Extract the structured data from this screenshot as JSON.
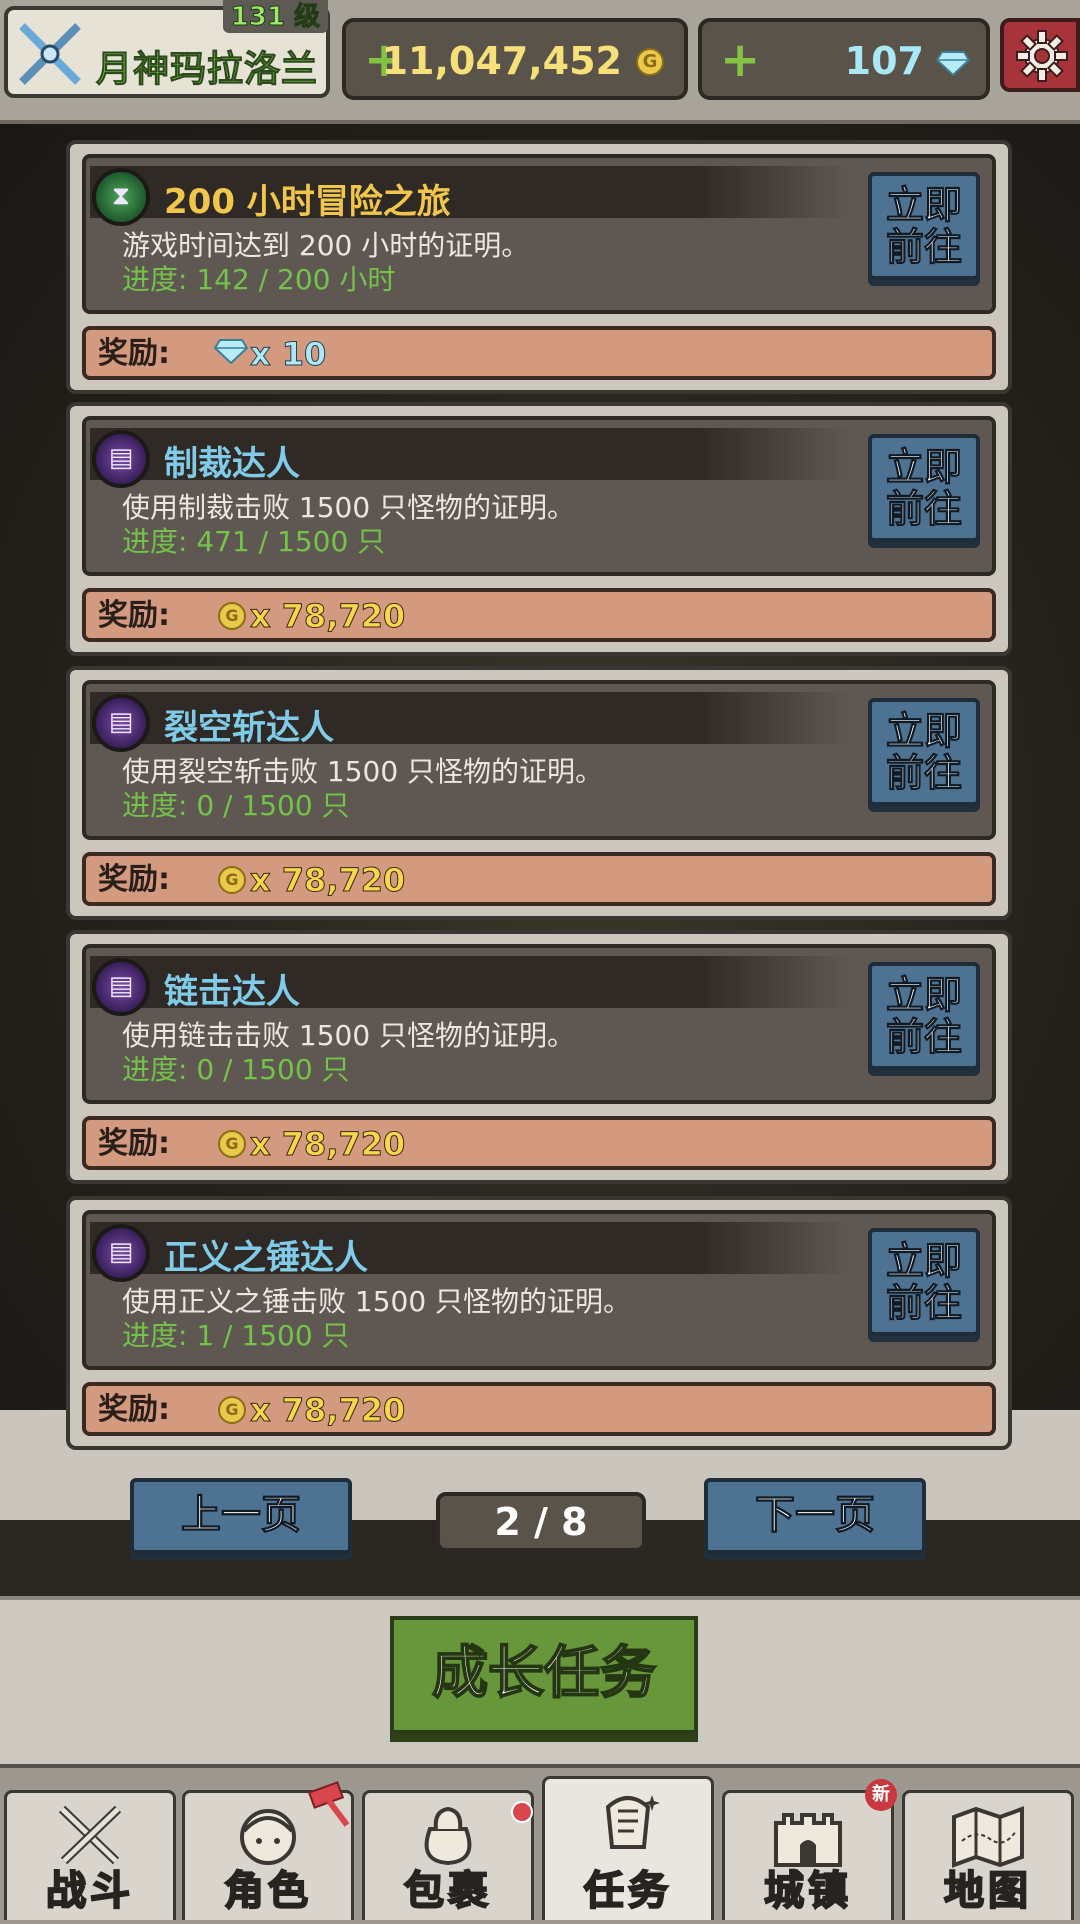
{
  "player": {
    "name": "月神玛拉洛兰",
    "level": "131 级"
  },
  "currency": {
    "gold": "11,047,452",
    "gems": "107"
  },
  "quests": [
    {
      "title": "200 小时冒险之旅",
      "icon": "hourglass-icon",
      "description": "游戏时间达到 200 小时的证明。",
      "progress": "进度: 142 / 200 小时",
      "go_label_1": "立即",
      "go_label_2": "前往",
      "reward_label": "奖励:",
      "reward_icon": "gem-icon",
      "reward_amount": "x 10"
    },
    {
      "title": "制裁达人",
      "icon": "skill-book-icon",
      "description": "使用制裁击败 1500 只怪物的证明。",
      "progress": "进度: 471 / 1500 只",
      "go_label_1": "立即",
      "go_label_2": "前往",
      "reward_label": "奖励:",
      "reward_icon": "gold-coin-icon",
      "reward_amount": "x 78,720"
    },
    {
      "title": "裂空斩达人",
      "icon": "skill-book-icon",
      "description": "使用裂空斩击败 1500 只怪物的证明。",
      "progress": "进度: 0 / 1500 只",
      "go_label_1": "立即",
      "go_label_2": "前往",
      "reward_label": "奖励:",
      "reward_icon": "gold-coin-icon",
      "reward_amount": "x 78,720"
    },
    {
      "title": "链击达人",
      "icon": "skill-book-icon",
      "description": "使用链击击败 1500 只怪物的证明。",
      "progress": "进度: 0 / 1500 只",
      "go_label_1": "立即",
      "go_label_2": "前往",
      "reward_label": "奖励:",
      "reward_icon": "gold-coin-icon",
      "reward_amount": "x 78,720"
    },
    {
      "title": "正义之锤达人",
      "icon": "skill-book-icon",
      "description": "使用正义之锤击败 1500 只怪物的证明。",
      "progress": "进度: 1 / 1500 只",
      "go_label_1": "立即",
      "go_label_2": "前往",
      "reward_label": "奖励:",
      "reward_icon": "gold-coin-icon",
      "reward_amount": "x 78,720"
    }
  ],
  "pager": {
    "prev": "上一页",
    "next": "下一页",
    "indicator": "2 / 8"
  },
  "category_button": "成长任务",
  "nav": [
    {
      "label": "战斗",
      "icon": "crossed-swords-icon"
    },
    {
      "label": "角色",
      "icon": "character-icon"
    },
    {
      "label": "包裹",
      "icon": "bag-icon"
    },
    {
      "label": "任务",
      "icon": "quest-icon",
      "active": true
    },
    {
      "label": "城镇",
      "icon": "castle-icon",
      "badge": "新"
    },
    {
      "label": "地图",
      "icon": "map-icon"
    }
  ],
  "colors": {
    "accent_green": "#68963b",
    "button_blue": "#4e7392",
    "title_gold": "#f1c64b",
    "title_blue": "#7fcbe8",
    "progress_green": "#74c24a"
  }
}
